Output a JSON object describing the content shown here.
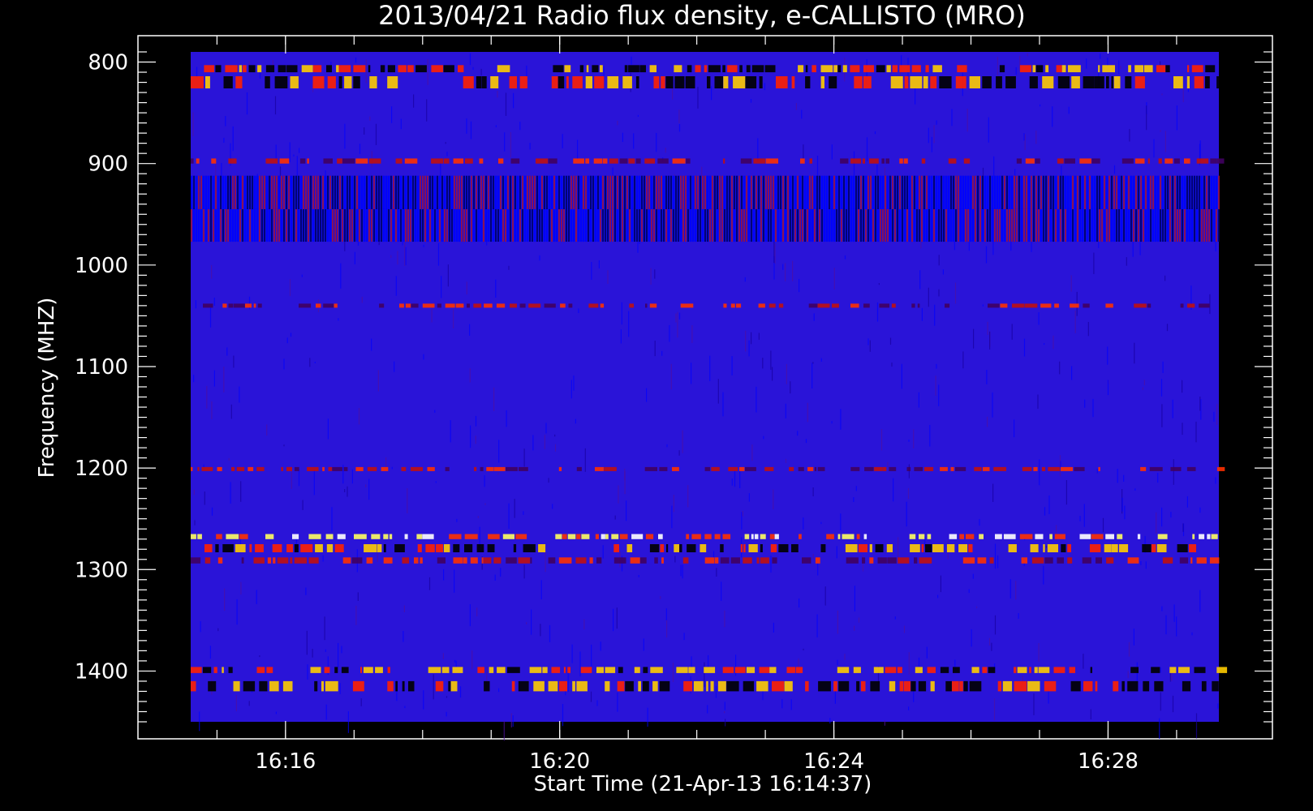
{
  "chart_data": {
    "type": "heatmap",
    "title": "2013/04/21  Radio flux density, e-CALLISTO (MRO)",
    "xlabel": "Start Time (21-Apr-13 16:14:37)",
    "ylabel": "Frequency (MHZ)",
    "x_ticks": [
      "16:16",
      "16:20",
      "16:24",
      "16:28"
    ],
    "y_ticks": [
      800,
      900,
      1000,
      1100,
      1200,
      1300,
      1400
    ],
    "x_range": [
      "16:14:37",
      "16:29:37"
    ],
    "y_range": [
      790,
      1450
    ],
    "y_axis_inverted": true,
    "colormap": [
      "#000000",
      "#0000ff",
      "#ff0000",
      "#ffff00",
      "#ffffff"
    ],
    "background_color": "#2a14d8",
    "emission_bands": [
      {
        "freq_start": 803,
        "freq_end": 810,
        "intensity": "strong"
      },
      {
        "freq_start": 814,
        "freq_end": 826,
        "intensity": "strong"
      },
      {
        "freq_start": 895,
        "freq_end": 900,
        "intensity": "moderate"
      },
      {
        "freq_start": 912,
        "freq_end": 945,
        "intensity": "striated"
      },
      {
        "freq_start": 945,
        "freq_end": 977,
        "intensity": "striated"
      },
      {
        "freq_start": 1038,
        "freq_end": 1042,
        "intensity": "moderate"
      },
      {
        "freq_start": 1199,
        "freq_end": 1203,
        "intensity": "moderate"
      },
      {
        "freq_start": 1265,
        "freq_end": 1270,
        "intensity": "very strong"
      },
      {
        "freq_start": 1275,
        "freq_end": 1283,
        "intensity": "strong"
      },
      {
        "freq_start": 1288,
        "freq_end": 1294,
        "intensity": "moderate"
      },
      {
        "freq_start": 1396,
        "freq_end": 1402,
        "intensity": "strong"
      },
      {
        "freq_start": 1410,
        "freq_end": 1420,
        "intensity": "strong"
      }
    ]
  }
}
